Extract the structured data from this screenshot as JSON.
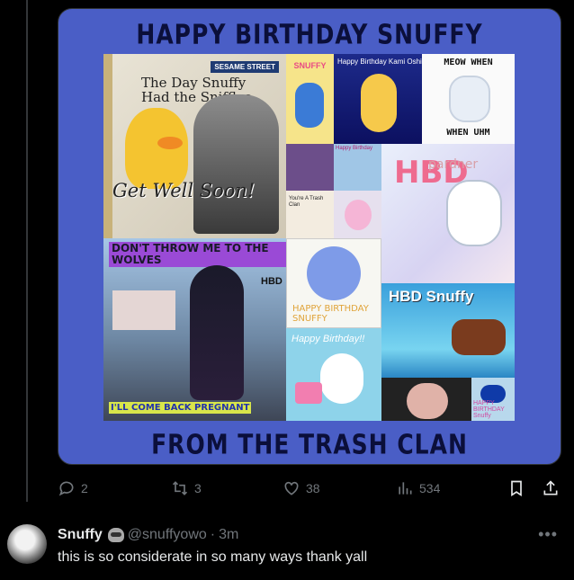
{
  "post": {
    "media": {
      "banner_top": "HAPPY BIRTHDAY SNUFFY",
      "banner_bottom": "FROM THE TRASH CLAN",
      "collage": {
        "book_sesame": "SESAME STREET",
        "book_title": "The Day Snuffy Had the Sniffles",
        "book_overlay": "Get Well Soon!",
        "snuffy_card": "SNUFFY",
        "sumo_card": "Happy Birthday Kami Oshi",
        "meow_top": "MEOW WHEN",
        "meow_bottom": "WHEN UHM",
        "mid_card_birthday": "Happy Birthday",
        "mid_card_note": "You're A Trash Clan",
        "hbd_card": "HBD",
        "pardner": "pardner",
        "wolves_caption_top": "DON'T THROW ME TO THE WOLVES",
        "wolves_hbd": "HBD",
        "wolves_caption_bottom": "I'LL COME BACK PREGNANT",
        "catcard_text": "HAPPY BIRTHDAY SNUFFY",
        "moomin_text": "Happy Birthday!!",
        "horse_text": "HBD Snuffy",
        "small_logo_text": "HAPPY BIRTHDAY Snuffy"
      }
    },
    "actions": {
      "replies": "2",
      "reposts": "3",
      "likes": "38",
      "views": "534"
    }
  },
  "reply": {
    "name": "Snuffy",
    "handle": "@snuffyowo",
    "separator": "·",
    "time": "3m",
    "text": "this is so considerate in so many ways thank yall"
  },
  "colors": {
    "background": "#000000",
    "muted": "#71767b",
    "text": "#e7e9ea",
    "media_frame": "#4a5ec6"
  },
  "icons": [
    "reply-icon",
    "repost-icon",
    "like-icon",
    "views-icon",
    "bookmark-icon",
    "share-icon",
    "more-icon",
    "raccoon-emoji-icon"
  ]
}
